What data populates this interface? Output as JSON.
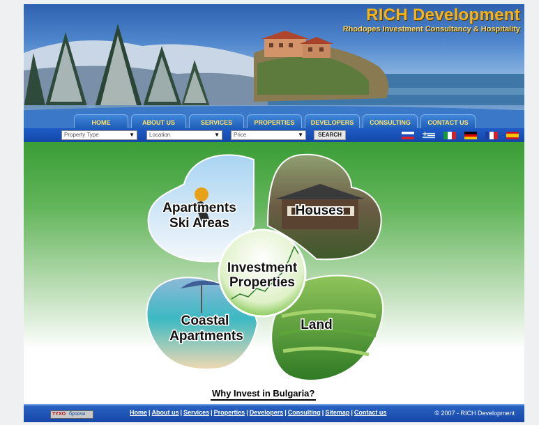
{
  "brand": {
    "title": "RICH Development",
    "subtitle": "Rhodopes Investment Consultancy & Hospitality"
  },
  "nav": [
    {
      "label": "HOME"
    },
    {
      "label": "ABOUT US"
    },
    {
      "label": "SERVICES"
    },
    {
      "label": "PROPERTIES"
    },
    {
      "label": "DEVELOPERS"
    },
    {
      "label": "CONSULTING"
    },
    {
      "label": "CONTACT US"
    }
  ],
  "search": {
    "property_type": "Property Type",
    "location": "Location",
    "price": "Price",
    "button": "SEARCH"
  },
  "flags": [
    "russian-flag",
    "greek-flag",
    "italian-flag",
    "german-flag",
    "french-flag",
    "spanish-flag"
  ],
  "clover": {
    "ski": [
      "Apartments",
      "Ski Areas"
    ],
    "houses": "Houses",
    "center": [
      "Investment",
      "Properties"
    ],
    "coastal": [
      "Coastal",
      "Apartments"
    ],
    "land": "Land"
  },
  "why_link": "Why Invest in Bulgaria?",
  "footer": {
    "counter": {
      "logo": "TYXO",
      "text": "броячи"
    },
    "links": [
      "Home",
      "About us",
      "Services",
      "Properties",
      "Developers",
      "Consulting",
      "Sitemap",
      "Contact us"
    ],
    "copyright": "© 2007 - RICH Development"
  },
  "colors": {
    "brand_gold": "#f4b21b",
    "nav_blue": "#1f5db7",
    "nav_text": "#ffe36a",
    "content_green": "#3a9d36"
  }
}
